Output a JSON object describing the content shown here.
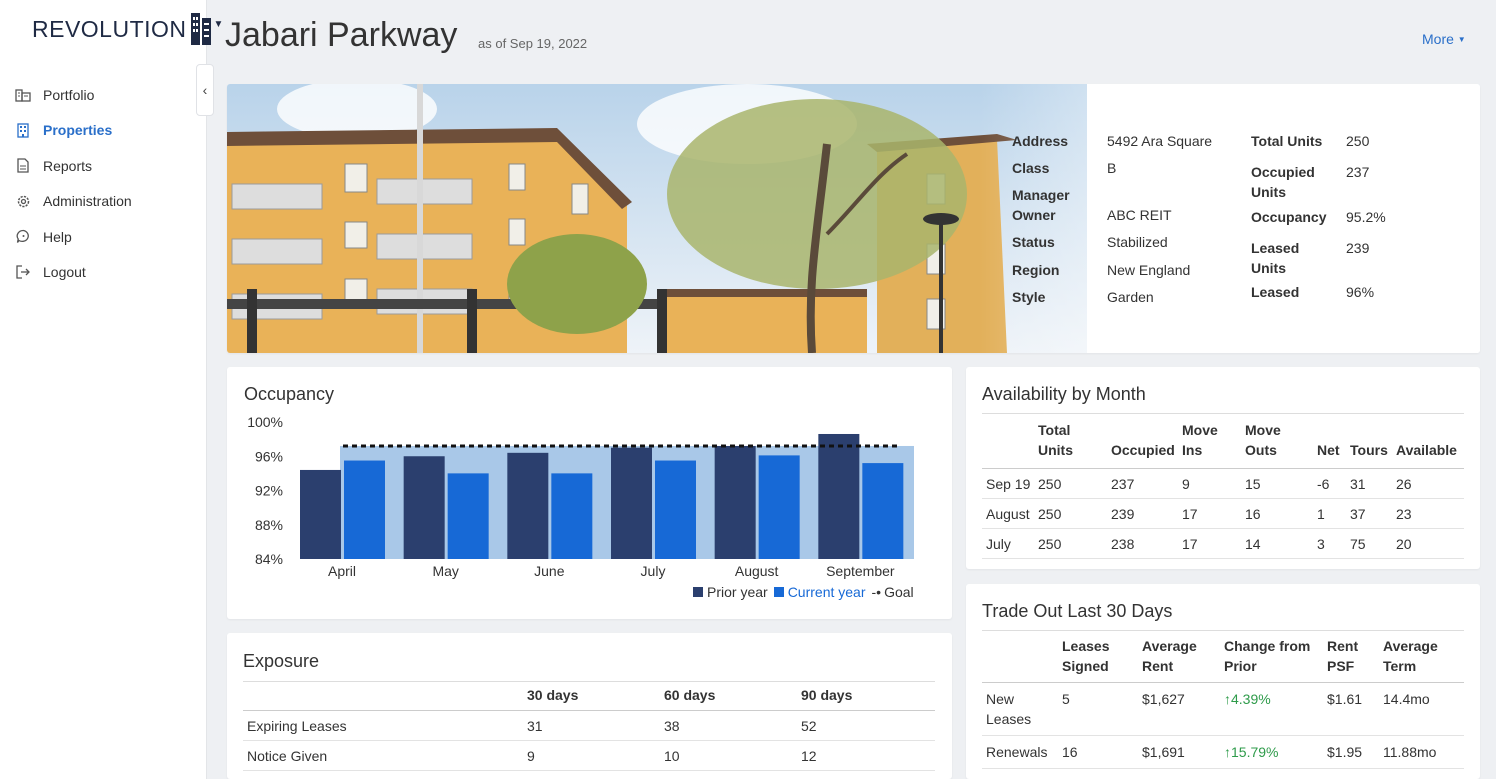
{
  "brand": {
    "name": "REVOLUTION"
  },
  "nav": [
    {
      "label": "Portfolio",
      "icon": "building-icon"
    },
    {
      "label": "Properties",
      "icon": "property-icon"
    },
    {
      "label": "Reports",
      "icon": "report-icon"
    },
    {
      "label": "Administration",
      "icon": "gear-icon"
    },
    {
      "label": "Help",
      "icon": "help-icon"
    },
    {
      "label": "Logout",
      "icon": "logout-icon"
    }
  ],
  "header": {
    "title": "Jabari Parkway",
    "as_of": "as of Sep 19, 2022",
    "more": "More"
  },
  "property": {
    "address_label": "Address",
    "address": "5492 Ara Square",
    "class_label": "Class",
    "class": "B",
    "manager_label": "Manager",
    "owner_label": "Owner",
    "owner": "ABC REIT",
    "status_label": "Status",
    "status": "Stabilized",
    "region_label": "Region",
    "region": "New England",
    "style_label": "Style",
    "style": "Garden",
    "total_units_label": "Total Units",
    "total_units": "250",
    "occupied_units_label_1": "Occupied",
    "occupied_units_label_2": "Units",
    "occupied_units": "237",
    "occupancy_label": "Occupancy",
    "occupancy": "95.2%",
    "leased_units_label_1": "Leased",
    "leased_units_label_2": "Units",
    "leased_units": "239",
    "leased_label": "Leased",
    "leased": "96%"
  },
  "occupancy": {
    "title": "Occupancy",
    "legend": {
      "prior": "Prior year",
      "current": "Current year",
      "goal": "Goal"
    },
    "colors": {
      "prior": "#2b3f6e",
      "current": "#1769d6",
      "band": "#a9c8e8"
    }
  },
  "chart_data": {
    "type": "bar",
    "title": "Occupancy",
    "categories": [
      "April",
      "May",
      "June",
      "July",
      "August",
      "September"
    ],
    "series": [
      {
        "name": "Prior year",
        "values": [
          94.4,
          96.0,
          96.4,
          97.0,
          97.2,
          98.6
        ]
      },
      {
        "name": "Current year",
        "values": [
          95.5,
          94.0,
          94.0,
          95.5,
          96.1,
          95.2
        ]
      },
      {
        "name": "Goal",
        "values": [
          97.2,
          97.2,
          97.2,
          97.2,
          97.2,
          97.2
        ]
      }
    ],
    "yticks": [
      "100%",
      "96%",
      "92%",
      "88%",
      "84%"
    ],
    "ylim": [
      84,
      100
    ]
  },
  "availability": {
    "title": "Availability by Month",
    "headers": [
      [
        "",
        ""
      ],
      [
        "Total",
        "Units"
      ],
      [
        "",
        "Occupied"
      ],
      [
        "Move",
        "Ins"
      ],
      [
        "Move",
        "Outs"
      ],
      [
        "",
        "Net"
      ],
      [
        "",
        "Tours"
      ],
      [
        "",
        "Available"
      ]
    ],
    "rows": [
      [
        "Sep 19",
        "250",
        "237",
        "9",
        "15",
        "-6",
        "31",
        "26"
      ],
      [
        "August",
        "250",
        "239",
        "17",
        "16",
        "1",
        "37",
        "23"
      ],
      [
        "July",
        "250",
        "238",
        "17",
        "14",
        "3",
        "75",
        "20"
      ]
    ]
  },
  "trade": {
    "title": "Trade Out Last 30 Days",
    "headers": [
      [
        "",
        ""
      ],
      [
        "Leases",
        "Signed"
      ],
      [
        "Average",
        "Rent"
      ],
      [
        "Change from",
        "Prior"
      ],
      [
        "Rent",
        "PSF"
      ],
      [
        "Average",
        "Term"
      ]
    ],
    "rows": [
      {
        "label1": "New",
        "label2": "Leases",
        "signed": "5",
        "rent": "$1,627",
        "change": "4.39%",
        "psf": "$1.61",
        "term": "14.4mo"
      },
      {
        "label1": "Renewals",
        "label2": "",
        "signed": "16",
        "rent": "$1,691",
        "change": "15.79%",
        "psf": "$1.95",
        "term": "11.88mo"
      }
    ]
  },
  "exposure": {
    "title": "Exposure",
    "headers": [
      "",
      "30 days",
      "60 days",
      "90 days"
    ],
    "rows": [
      [
        "Expiring Leases",
        "31",
        "38",
        "52"
      ],
      [
        "Notice Given",
        "9",
        "10",
        "12"
      ]
    ]
  }
}
